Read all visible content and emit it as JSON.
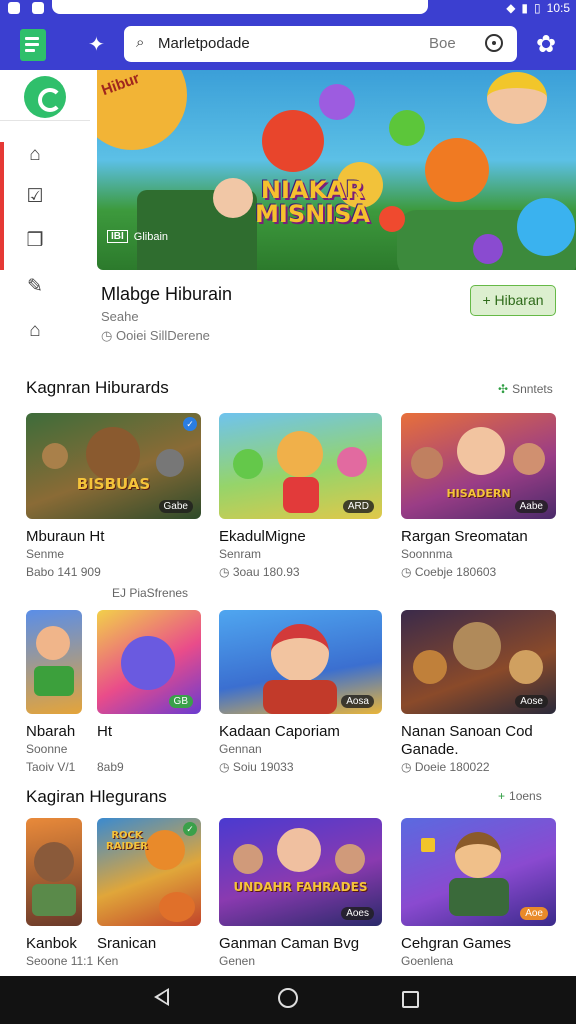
{
  "status": {
    "time": "10:5",
    "icons": [
      "wifi-icon",
      "signal-icon",
      "battery-icon"
    ]
  },
  "header": {
    "search_query": "Marletpodade",
    "search_hint": "Boe",
    "icons": [
      "puzzle-icon",
      "search-icon",
      "voice-icon",
      "gear-icon"
    ]
  },
  "colors": {
    "brand": "#3b3fd0",
    "accent_green": "#2fbf6b",
    "active_red": "#e53935"
  },
  "rail": {
    "items": [
      "home-icon",
      "checklist-icon",
      "library-icon",
      "rocket-icon",
      "settings-house-icon"
    ]
  },
  "hero": {
    "sign_text": "Hibur",
    "title_line1": "NIAKAR",
    "title_line2": "MISNISA",
    "caption_badge": "IBI",
    "caption_text": "Glibain"
  },
  "featured": {
    "title": "Mlabge Hiburain",
    "subtitle": "Seahe",
    "meta": "Ooiei SillDerene",
    "button_label": "Hibaran",
    "button_icon": "+"
  },
  "section1": {
    "title": "Kagnran  Hiburards",
    "action_label": "Snntets",
    "note": "EJ PiaSfrenes",
    "cards": [
      {
        "name": "Mburaun  Ht",
        "sub": "Senme",
        "meta": "Babo 141 909",
        "badge": "Gabe",
        "thumb_title": "BISBUAS"
      },
      {
        "name": "EkadulMigne",
        "sub": "Senram",
        "meta": "3oau 180.93",
        "badge": "ARD",
        "thumb_title": ""
      },
      {
        "name": "Rargan Sreomatan",
        "sub": "Soonnma",
        "meta": "Coebje 180603",
        "badge": "Aabe",
        "thumb_title": "HISADERN"
      }
    ]
  },
  "section1b": {
    "cards": [
      {
        "name": "Nbarah",
        "sub": "Soonne",
        "meta": "Taoiv V/1",
        "badge": ""
      },
      {
        "name": "Ht",
        "sub": "",
        "meta": "8ab9",
        "badge": "GB"
      },
      {
        "name": "Kadaan Caporiam",
        "sub": "Gennan",
        "meta": "Soiu 19033",
        "badge": "Aosa"
      },
      {
        "name": "Nanan Sanoan Cod",
        "sub": "Ganade.",
        "meta": "Doeie 180022",
        "badge": "Aose"
      }
    ]
  },
  "section2": {
    "title": "Kagiran  Hlegurans",
    "action_label": "1oens",
    "cards": [
      {
        "name": "Kanbok",
        "sub": "Seoone 11:1",
        "thumb_title": ""
      },
      {
        "name": "Sranican",
        "sub": "Ken",
        "thumb_title": "ROCK RAIDER"
      },
      {
        "name": "Ganman Caman Bvg",
        "sub": "Genen",
        "badge": "Aoes",
        "thumb_title": "UNDAHR FAHRADES"
      },
      {
        "name": "Cehgran Games",
        "sub": "Goenlena",
        "badge": "Aoe",
        "thumb_title": ""
      }
    ]
  },
  "navbar": {
    "icons": [
      "back-icon",
      "home-icon",
      "recents-icon"
    ]
  }
}
